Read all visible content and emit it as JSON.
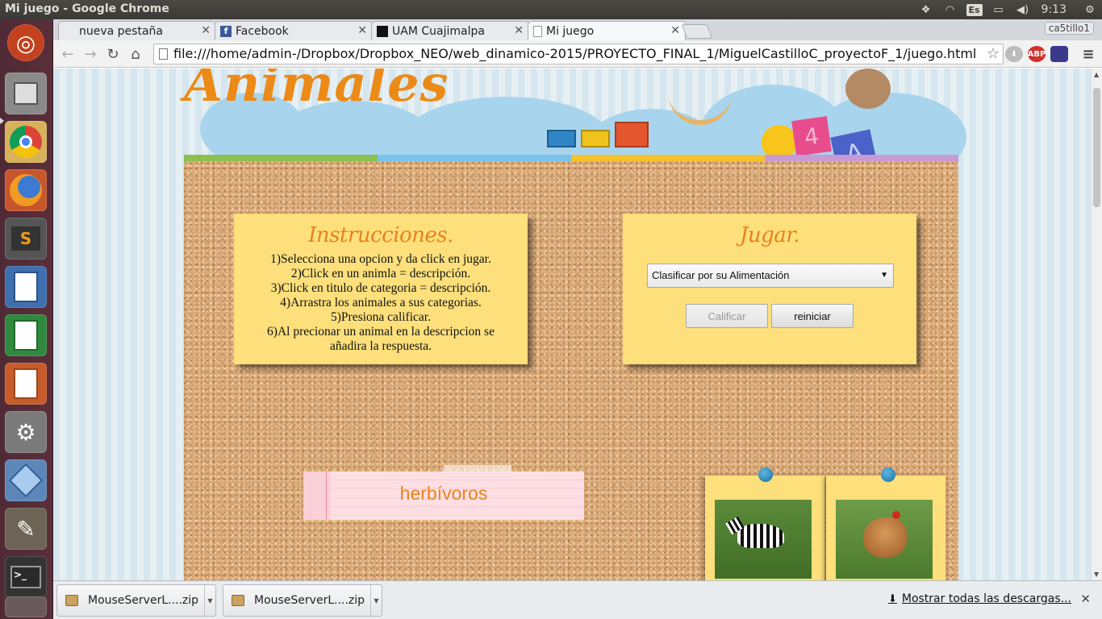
{
  "window": {
    "title": "Mi juego - Google Chrome"
  },
  "tray": {
    "lang": "Es",
    "time": "9:13"
  },
  "launcher": [
    "ubuntu-dash-icon",
    "files-icon",
    "chrome-icon",
    "firefox-icon",
    "sublime-text-icon",
    "libreoffice-impress-doc-icon",
    "libreoffice-calc-icon",
    "libreoffice-impress-icon",
    "system-settings-icon",
    "virtualbox-icon",
    "gimp-icon",
    "terminal-icon",
    "trash-icon"
  ],
  "tabs": [
    {
      "label": "nueva pestaña",
      "icon": ""
    },
    {
      "label": "Facebook",
      "icon": "f"
    },
    {
      "label": "UAM Cuajimalpa",
      "icon": ""
    },
    {
      "label": "Mi juego",
      "icon": ""
    }
  ],
  "profile": "ca5tillo1",
  "address": {
    "url": "file:///home/admin-/Dropbox/Dropbox_NEO/web_dinamico-2015/PROYECTO_FINAL_1/MiguelCastilloC_proyectoF_1/juego.html"
  },
  "extensions": {
    "abp": "ABP"
  },
  "page": {
    "logo": "Animales",
    "instructions": {
      "title": "Instrucciones.",
      "lines": [
        "1)Selecciona una opcion y da click en jugar.",
        "2)Click en un animla = descripción.",
        "3)Click en titulo de categoria = descripción.",
        "4)Arrastra los animales a sus categorias.",
        "5)Presiona calificar.",
        "6)Al precionar un animal en la descripcion se añadira la respuesta."
      ]
    },
    "play": {
      "title": "Jugar.",
      "select_value": "Clasificar por su Alimentación",
      "grade_button": "Calificar",
      "reset_button": "reiniciar"
    },
    "category_title": "herbívoros",
    "animals": [
      "zebra",
      "hen"
    ]
  },
  "downloads": {
    "items": [
      "MouseServerL....zip",
      "MouseServerL....zip"
    ],
    "show_all": "Mostrar todas las descargas..."
  },
  "colors": {
    "accent_orange": "#ec8a17",
    "note_yellow": "#fde07c",
    "launcher_bg": "#5a2f3a",
    "panel_bg": "#3c3b37"
  }
}
